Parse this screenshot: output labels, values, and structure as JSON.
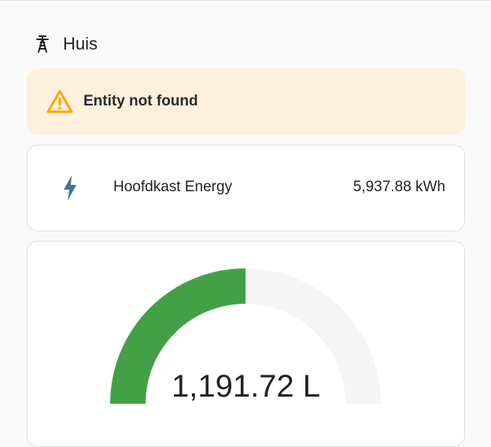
{
  "section": {
    "title": "Huis",
    "icon": "transmission-tower-icon"
  },
  "warning": {
    "text": "Entity not found",
    "icon": "alert-triangle-icon",
    "color": "#ffa600",
    "background": "#fdf0dc"
  },
  "entity": {
    "name": "Hoofdkast Energy",
    "value": "5,937.88 kWh",
    "icon": "lightning-bolt-icon",
    "icon_color": "#44739e"
  },
  "gauge": {
    "value_text": "1,191.72 L",
    "fill_fraction": 0.5,
    "fill_color": "#43a047",
    "track_color": "#f5f5f5"
  }
}
